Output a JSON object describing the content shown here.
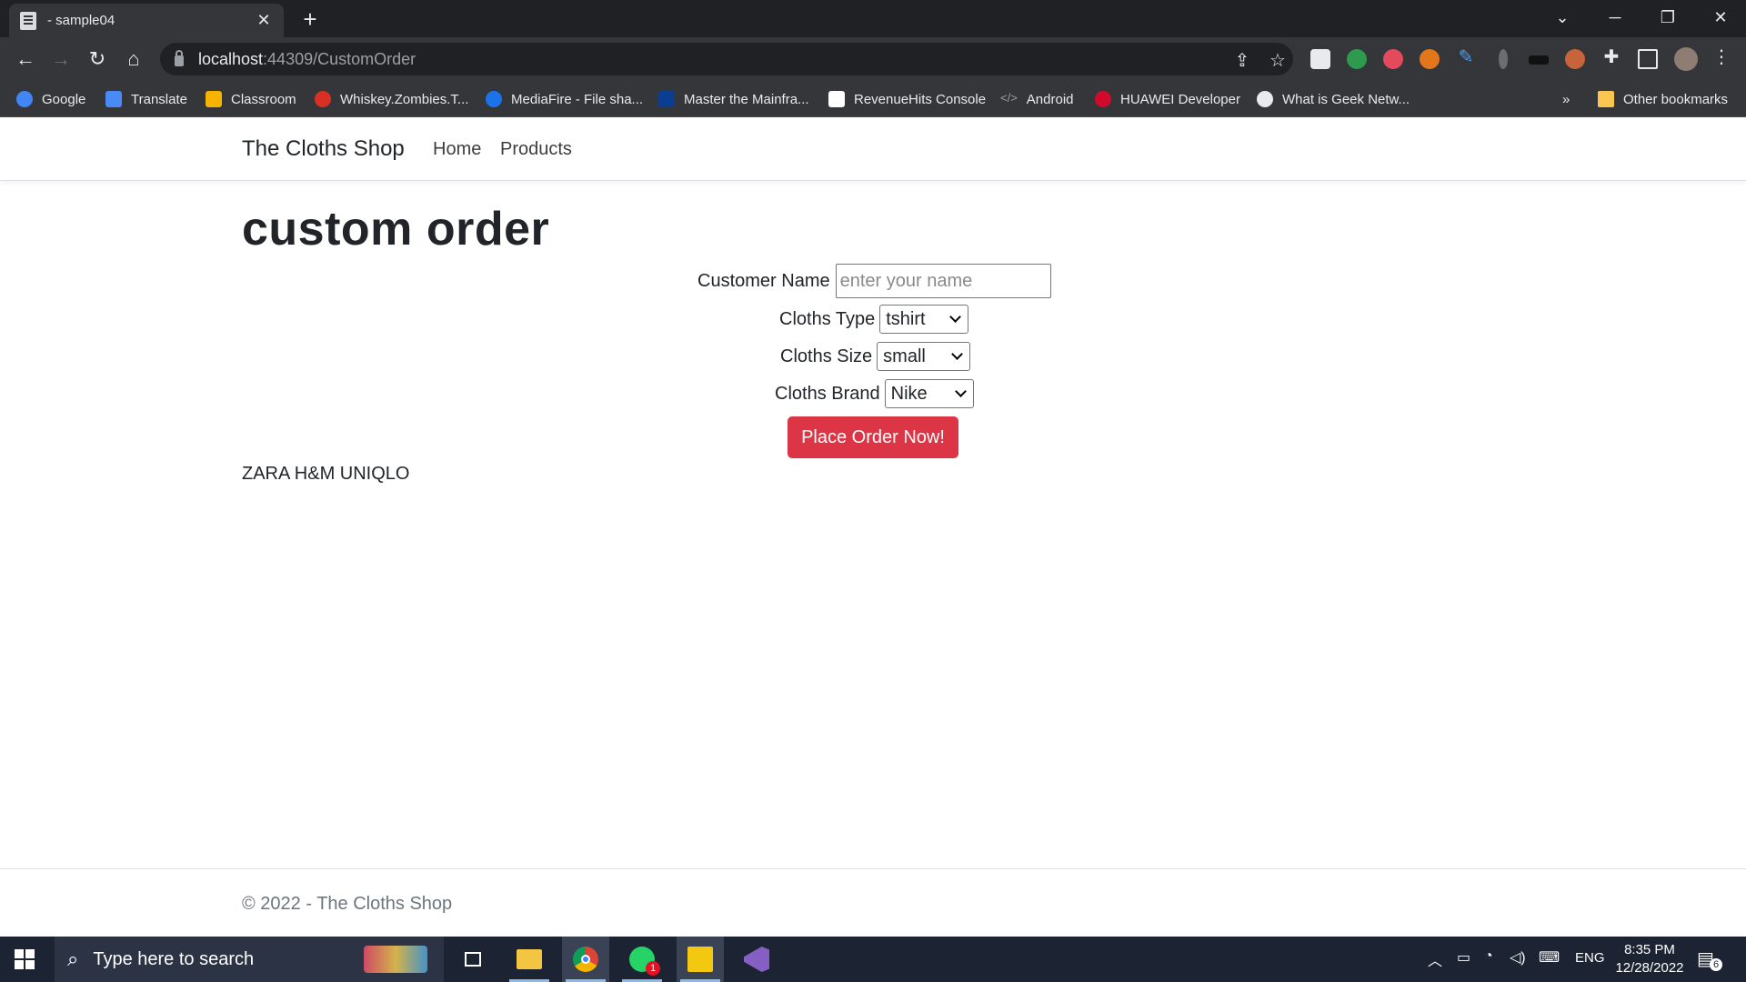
{
  "browser": {
    "tab_title": "- sample04",
    "tab_close": "✕",
    "new_tab": "+",
    "url_host": "localhost",
    "url_rest": ":44309/CustomOrder",
    "bookmarks": [
      {
        "label": "Google",
        "icon": "google-icon",
        "color": "#4285f4"
      },
      {
        "label": "Translate",
        "icon": "translate-icon",
        "color": "#4a8af4"
      },
      {
        "label": "Classroom",
        "icon": "classroom-icon",
        "color": "#f4b400"
      },
      {
        "label": "Whiskey.Zombies.T...",
        "icon": "whiskey-icon",
        "color": "#d93025"
      },
      {
        "label": "MediaFire - File sha...",
        "icon": "mediafire-icon",
        "color": "#1a73e8"
      },
      {
        "label": "Master the Mainfra...",
        "icon": "mainframe-icon",
        "color": "#0b3d91"
      },
      {
        "label": "RevenueHits Console",
        "icon": "revenuehits-icon",
        "color": "#ffffff"
      },
      {
        "label": "Android",
        "icon": "code-icon",
        "color": "#9aa0a6"
      },
      {
        "label": "HUAWEI Developer",
        "icon": "huawei-icon",
        "color": "#cf0a2c"
      },
      {
        "label": "What is Geek Netw...",
        "icon": "globe-icon",
        "color": "#e8eaed"
      }
    ],
    "bookmarks_overflow": "»",
    "other_bookmarks": "Other bookmarks"
  },
  "site": {
    "brand": "The Cloths Shop",
    "nav": [
      "Home",
      "Products"
    ]
  },
  "page": {
    "title": "custom order",
    "form": {
      "name_label": "Customer Name",
      "name_placeholder": "enter your name",
      "type_label": "Cloths Type",
      "type_value": "tshirt",
      "size_label": "Cloths Size",
      "size_value": "small",
      "brand_label": "Cloths Brand",
      "brand_value": "Nike",
      "submit_label": "Place Order Now!"
    },
    "brand_list": "ZARA H&M UNIQLO"
  },
  "footer": {
    "text": "© 2022 - The Cloths Shop"
  },
  "taskbar": {
    "search_placeholder": "Type here to search",
    "tray_lang": "ENG",
    "time": "8:35 PM",
    "date": "12/28/2022",
    "notification_count": "6",
    "whatsapp_badge": "1"
  },
  "colors": {
    "accent_button": "#dc3545",
    "browser_frame": "#202124",
    "browser_toolbar": "#35363a",
    "taskbar": "#1c2433"
  }
}
